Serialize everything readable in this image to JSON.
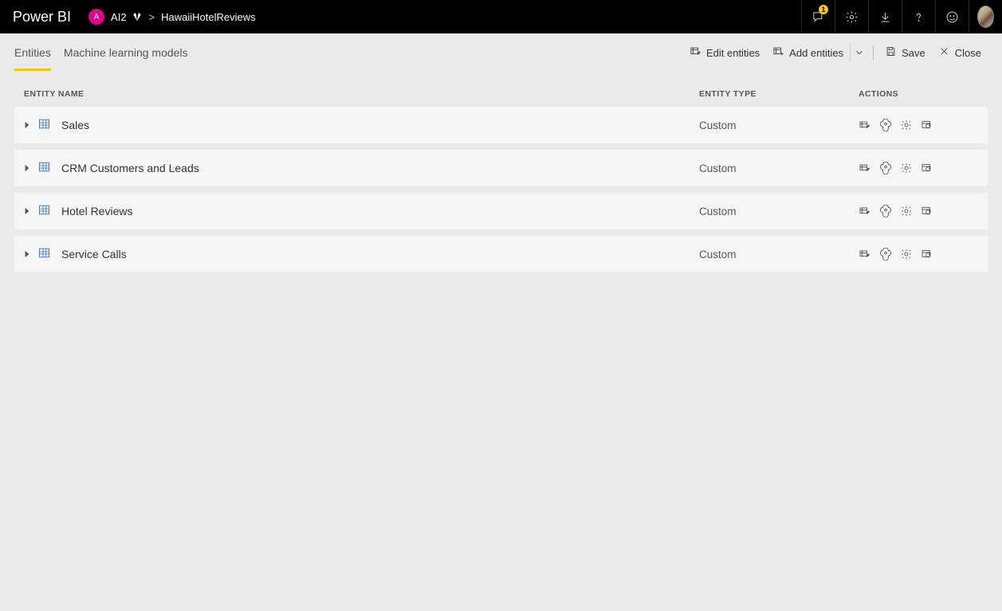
{
  "header": {
    "brand": "Power BI",
    "workspace_initial": "A",
    "workspace_name": "AI2",
    "breadcrumb_sep": ">",
    "breadcrumb_item": "HawaiiHotelReviews",
    "notification_count": "1"
  },
  "tabs": {
    "entities": "Entities",
    "ml_models": "Machine learning models"
  },
  "toolbar": {
    "edit_entities": "Edit entities",
    "add_entities": "Add entities",
    "save": "Save",
    "close": "Close"
  },
  "columns": {
    "name": "ENTITY NAME",
    "type": "ENTITY TYPE",
    "actions": "ACTIONS"
  },
  "entities": [
    {
      "name": "Sales",
      "type": "Custom"
    },
    {
      "name": "CRM Customers and Leads",
      "type": "Custom"
    },
    {
      "name": "Hotel Reviews",
      "type": "Custom"
    },
    {
      "name": "Service Calls",
      "type": "Custom"
    }
  ]
}
